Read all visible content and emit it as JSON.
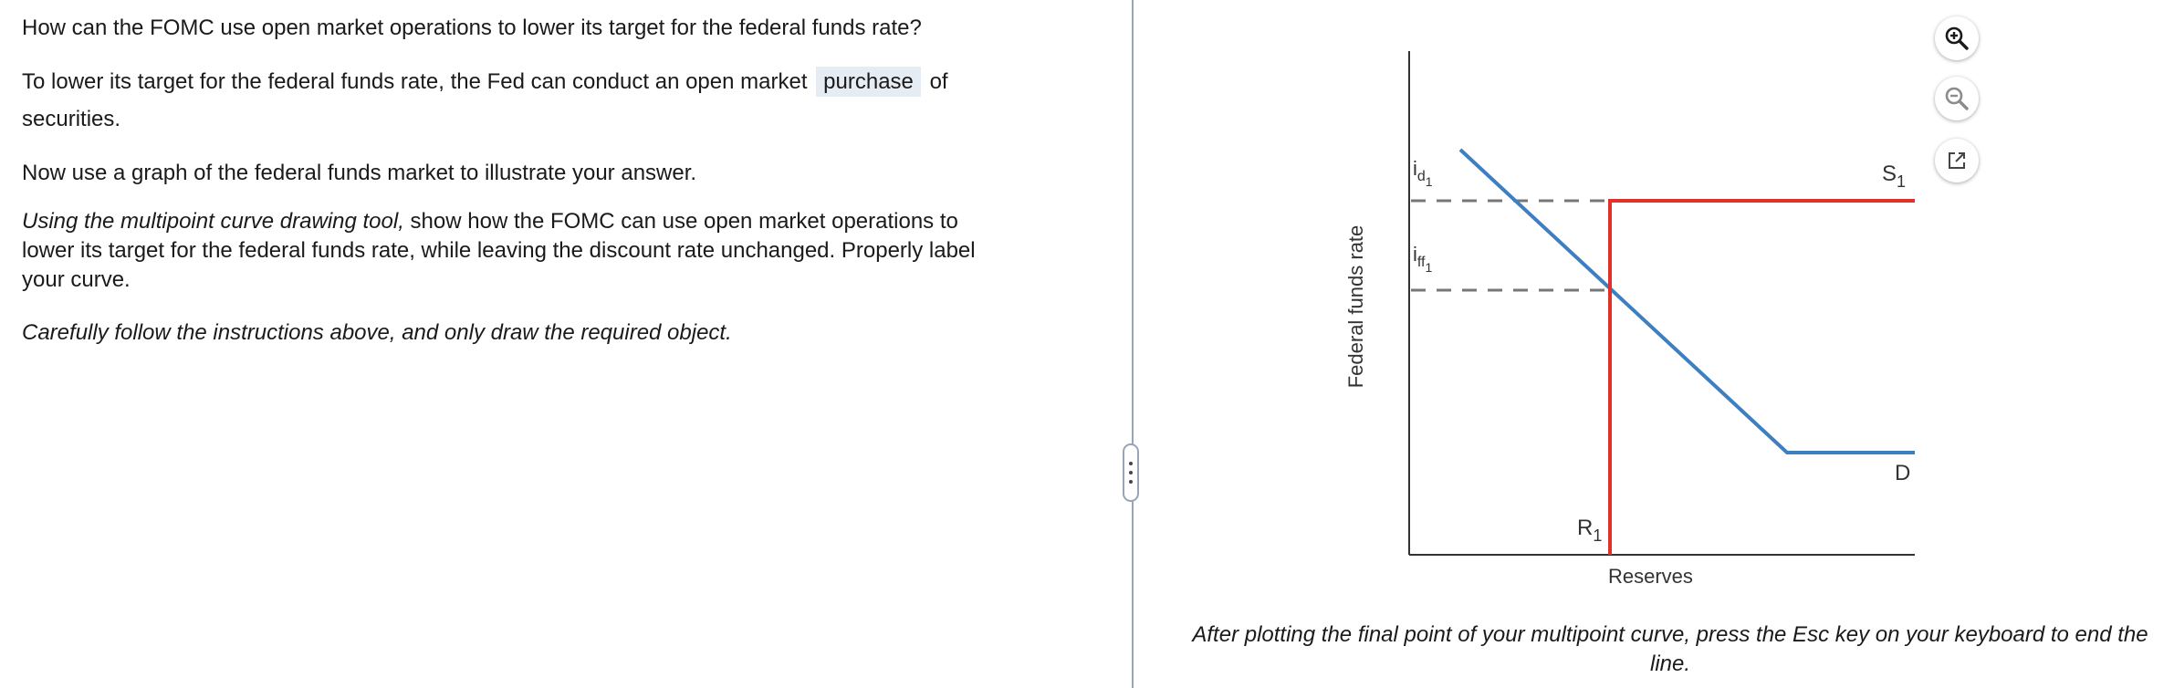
{
  "question": {
    "q1": "How can the FOMC use open market operations to lower its target for the federal funds rate?",
    "a1_before": "To lower its target for the federal funds rate, the Fed can conduct an open market",
    "a1_selected": "purchase",
    "a1_after": "of",
    "a1_line2": "securities.",
    "q2": "Now use a graph of the federal funds market to illustrate your answer.",
    "instr_italic": "Using the multipoint curve drawing tool,",
    "instr_rest_line1": "show how the FOMC can use open market operations to",
    "instr_line2": "lower its target for the federal funds rate, while leaving the discount rate unchanged. Properly label",
    "instr_line3": "your curve.",
    "caution": "Carefully follow the instructions above, and only draw the required object."
  },
  "graph": {
    "ylabel": "Federal funds rate",
    "xlabel": "Reserves",
    "label_id": "i",
    "label_id_sub": "d",
    "label_id_subsub": "1",
    "label_iff": "i",
    "label_iff_sub": "ff",
    "label_iff_subsub": "1",
    "label_S": "S",
    "label_S_sub": "1",
    "label_D": "D",
    "label_R": "R",
    "label_R_sub": "1",
    "colors": {
      "supply": "#e0322a",
      "demand": "#3e7fc1",
      "dashed": "#777777",
      "axis": "#333333"
    }
  },
  "footer_note": "After plotting the final point of your multipoint curve, press the Esc key on your keyboard to end the line.",
  "tools": [
    "zoom-in-icon",
    "zoom-out-icon",
    "popout-icon"
  ]
}
